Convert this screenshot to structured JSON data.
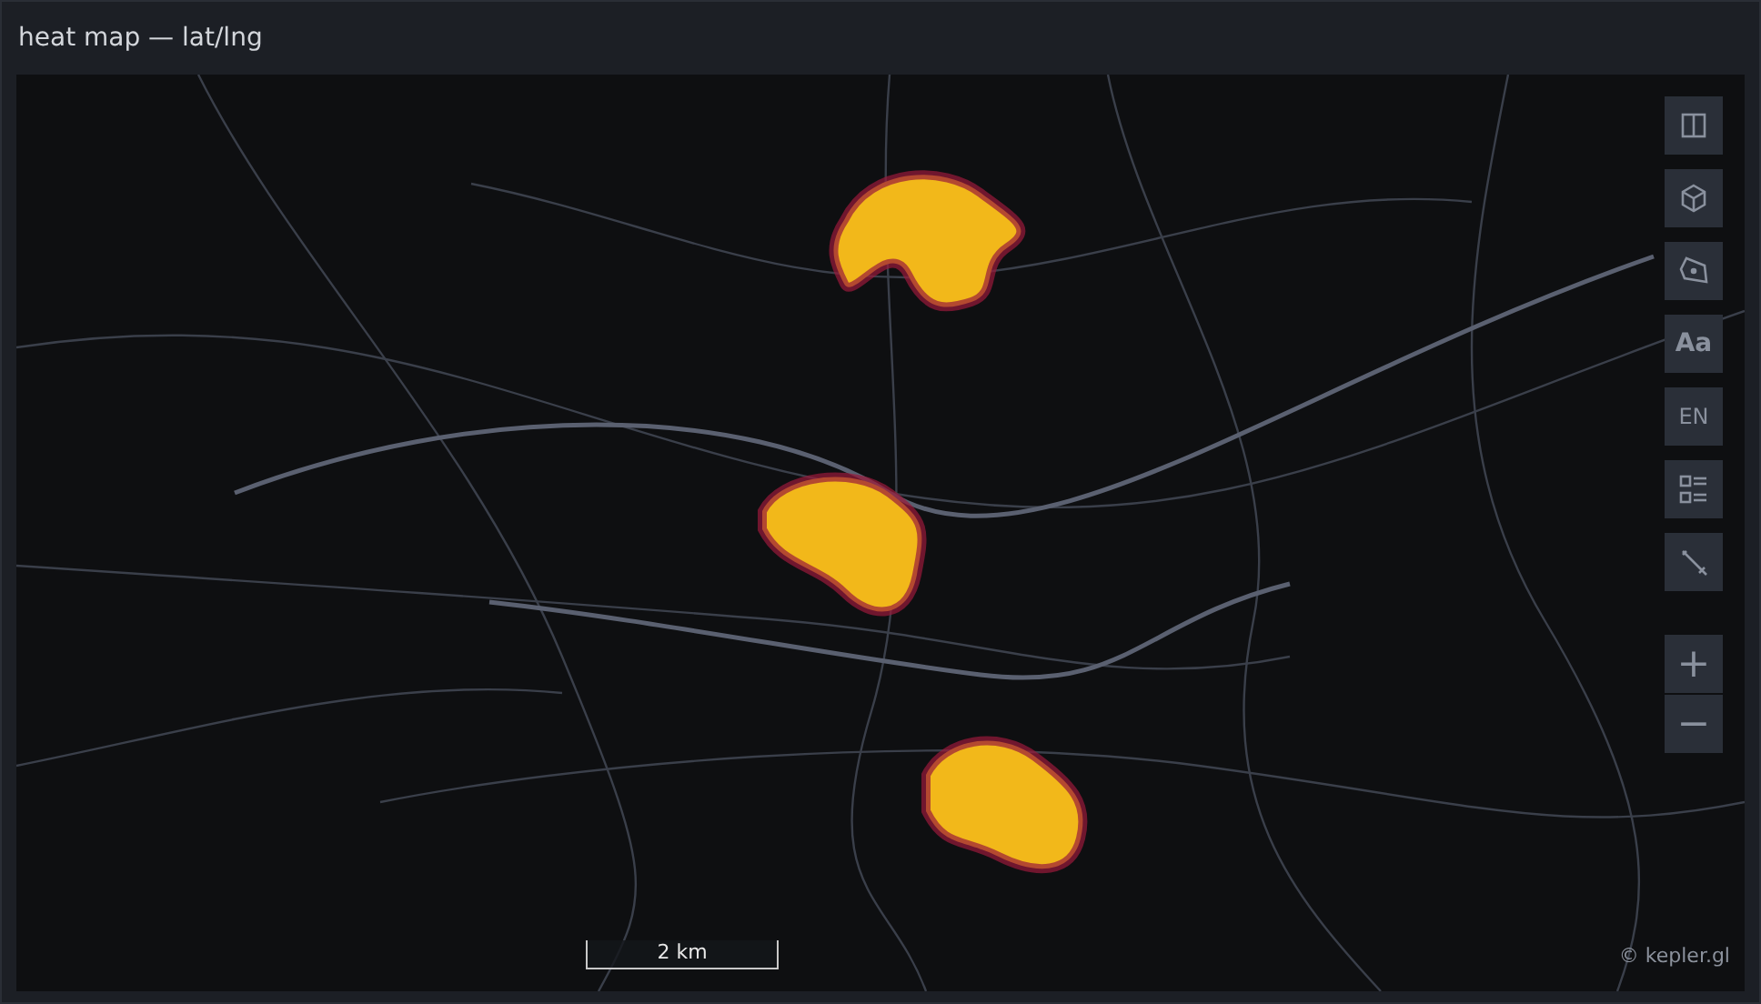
{
  "title": "heat map — lat/lng",
  "map_controls": [
    {
      "kind": "split"
    },
    {
      "kind": "cube"
    },
    {
      "kind": "draw"
    },
    {
      "kind": "text",
      "label": "Aa"
    },
    {
      "kind": "text",
      "label": "EN"
    },
    {
      "kind": "legend"
    },
    {
      "kind": "pencil"
    }
  ],
  "zoom": {
    "in": "+",
    "out": "−"
  },
  "scale": "2 km",
  "attribution": "© kepler.gl"
}
